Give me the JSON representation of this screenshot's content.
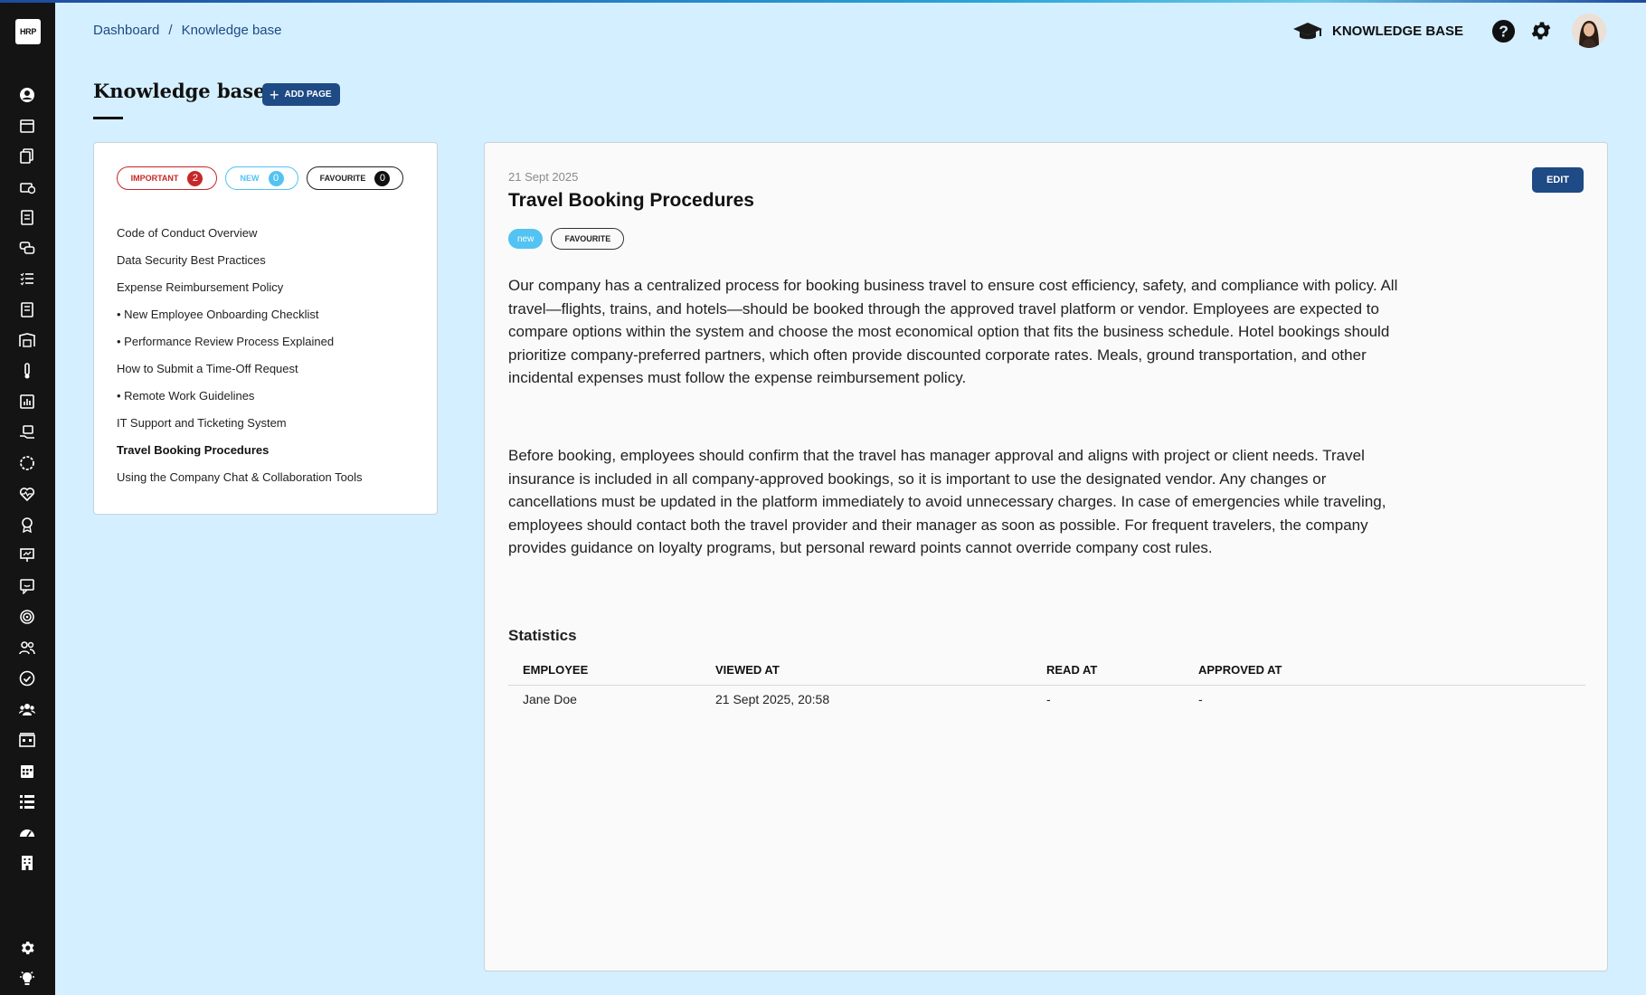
{
  "app": {
    "logo_text": "HRP"
  },
  "rail": {
    "icons": [
      "user-circle-icon",
      "calendar-icon",
      "documents-icon",
      "briefcase-clock-icon",
      "clipboard-icon",
      "chat-bubbles-icon",
      "checklist-icon",
      "contract-icon",
      "warehouse-icon",
      "thermometer-icon",
      "bar-chart-icon",
      "hand-box-icon",
      "circle-dots-icon",
      "heart-pulse-icon",
      "award-icon",
      "presentation-chart-icon",
      "feedback-icon",
      "target-icon",
      "users-icon",
      "check-circle-icon",
      "team-icon",
      "building-calendar-icon",
      "calendar-grid-icon",
      "list-icon",
      "speedometer-icon",
      "building-icon"
    ],
    "bottom_icons": [
      "settings-icon",
      "lightbulb-icon"
    ]
  },
  "breadcrumb": {
    "items": [
      "Dashboard",
      "Knowledge base"
    ],
    "separator": "/"
  },
  "header": {
    "section_label": "KNOWLEDGE BASE"
  },
  "page": {
    "title": "Knowledge base",
    "add_button": "ADD PAGE"
  },
  "filters": [
    {
      "label": "IMPORTANT",
      "count": "2"
    },
    {
      "label": "NEW",
      "count": "0"
    },
    {
      "label": "FAVOURITE",
      "count": "0"
    }
  ],
  "articles": [
    {
      "title": "Code of Conduct Overview"
    },
    {
      "title": "Data Security Best Practices"
    },
    {
      "title": "Expense Reimbursement Policy"
    },
    {
      "title": "• New Employee Onboarding Checklist"
    },
    {
      "title": "• Performance Review Process Explained"
    },
    {
      "title": "How to Submit a Time-Off Request"
    },
    {
      "title": "• Remote Work Guidelines"
    },
    {
      "title": "IT Support and Ticketing System"
    },
    {
      "title": "Travel Booking Procedures",
      "active": true
    },
    {
      "title": "Using the Company Chat & Collaboration Tools"
    }
  ],
  "article": {
    "date": "21 Sept 2025",
    "title": "Travel Booking Procedures",
    "edit_label": "EDIT",
    "tags": {
      "new": "new",
      "favourite": "FAVOURITE"
    },
    "paragraphs": [
      "Our company has a centralized process for booking business travel to ensure cost efficiency, safety, and compliance with policy. All travel—flights, trains, and hotels—should be booked through the approved travel platform or vendor. Employees are expected to compare options within the system and choose the most economical option that fits the business schedule. Hotel bookings should prioritize company-preferred partners, which often provide discounted corporate rates. Meals, ground transportation, and other incidental expenses must follow the expense reimbursement policy.",
      "Before booking, employees should confirm that the travel has manager approval and aligns with project or client needs. Travel insurance is included in all company-approved bookings, so it is important to use the designated vendor. Any changes or cancellations must be updated in the platform immediately to avoid unnecessary charges. In case of emergencies while traveling, employees should contact both the travel provider and their manager as soon as possible. For frequent travelers, the company provides guidance on loyalty programs, but personal reward points cannot override company cost rules."
    ]
  },
  "statistics": {
    "title": "Statistics",
    "columns": [
      "EMPLOYEE",
      "VIEWED AT",
      "READ AT",
      "APPROVED AT"
    ],
    "rows": [
      [
        "Jane Doe",
        "21 Sept 2025, 20:58",
        "-",
        "-"
      ]
    ]
  },
  "colors": {
    "primary": "#1e4a85",
    "background": "#d4efff",
    "important": "#c62828",
    "new": "#52c3f2",
    "rail": "#141414"
  }
}
